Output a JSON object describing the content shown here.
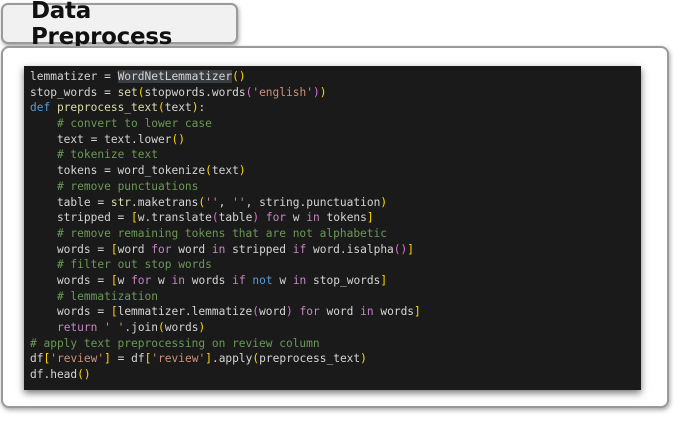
{
  "header": {
    "title": "Data Preprocess"
  },
  "colors": {
    "code_background": "#1a1a1b",
    "keyword": "#569cd6",
    "control_keyword": "#c586c0",
    "string": "#ce9178",
    "comment": "#6a9955",
    "function": "#dcdcaa",
    "plain": "#d4d4d4"
  },
  "code": {
    "language": "python",
    "lines": [
      [
        [
          "plain",
          "lemmatizer = "
        ],
        [
          "hl",
          "WordNetLemmatizer"
        ],
        [
          "paren",
          "()"
        ]
      ],
      [
        [
          "plain",
          "stop_words = "
        ],
        [
          "builtin",
          "set"
        ],
        [
          "paren",
          "("
        ],
        [
          "plain",
          "stopwords.words"
        ],
        [
          "bracket",
          "("
        ],
        [
          "str",
          "'english'"
        ],
        [
          "bracket",
          ")"
        ],
        [
          "paren",
          ")"
        ]
      ],
      [
        [
          "kw",
          "def "
        ],
        [
          "fn",
          "preprocess_text"
        ],
        [
          "paren",
          "("
        ],
        [
          "plain",
          "text"
        ],
        [
          "paren",
          ")"
        ],
        [
          "plain",
          ":"
        ]
      ],
      [
        [
          "plain",
          "    "
        ],
        [
          "comment",
          "# convert to lower case"
        ]
      ],
      [
        [
          "plain",
          "    text = text.lower"
        ],
        [
          "paren",
          "()"
        ]
      ],
      [
        [
          "plain",
          "    "
        ],
        [
          "comment",
          "# tokenize text"
        ]
      ],
      [
        [
          "plain",
          "    tokens = word_tokenize"
        ],
        [
          "paren",
          "("
        ],
        [
          "plain",
          "text"
        ],
        [
          "paren",
          ")"
        ]
      ],
      [
        [
          "plain",
          "    "
        ],
        [
          "comment",
          "# remove punctuations"
        ]
      ],
      [
        [
          "plain",
          "    table = "
        ],
        [
          "builtin",
          "str"
        ],
        [
          "plain",
          ".maketrans"
        ],
        [
          "paren",
          "("
        ],
        [
          "str",
          "''"
        ],
        [
          "plain",
          ", "
        ],
        [
          "str",
          "''"
        ],
        [
          "plain",
          ", string.punctuation"
        ],
        [
          "paren",
          ")"
        ]
      ],
      [
        [
          "plain",
          "    stripped = "
        ],
        [
          "paren",
          "["
        ],
        [
          "plain",
          "w.translate"
        ],
        [
          "bracket",
          "("
        ],
        [
          "plain",
          "table"
        ],
        [
          "bracket",
          ")"
        ],
        [
          "plain",
          " "
        ],
        [
          "ctrl",
          "for"
        ],
        [
          "plain",
          " w "
        ],
        [
          "ctrl",
          "in"
        ],
        [
          "plain",
          " tokens"
        ],
        [
          "paren",
          "]"
        ]
      ],
      [
        [
          "plain",
          "    "
        ],
        [
          "comment",
          "# remove remaining tokens that are not alphabetic"
        ]
      ],
      [
        [
          "plain",
          "    words = "
        ],
        [
          "paren",
          "["
        ],
        [
          "plain",
          "word "
        ],
        [
          "ctrl",
          "for"
        ],
        [
          "plain",
          " word "
        ],
        [
          "ctrl",
          "in"
        ],
        [
          "plain",
          " stripped "
        ],
        [
          "ctrl",
          "if"
        ],
        [
          "plain",
          " word.isalpha"
        ],
        [
          "bracket",
          "()"
        ],
        [
          "paren",
          "]"
        ]
      ],
      [
        [
          "plain",
          "    "
        ],
        [
          "comment",
          "# filter out stop words"
        ]
      ],
      [
        [
          "plain",
          "    words = "
        ],
        [
          "paren",
          "["
        ],
        [
          "plain",
          "w "
        ],
        [
          "ctrl",
          "for"
        ],
        [
          "plain",
          " w "
        ],
        [
          "ctrl",
          "in"
        ],
        [
          "plain",
          " words "
        ],
        [
          "ctrl",
          "if"
        ],
        [
          "plain",
          " "
        ],
        [
          "kw",
          "not"
        ],
        [
          "plain",
          " w "
        ],
        [
          "ctrl",
          "in"
        ],
        [
          "plain",
          " stop_words"
        ],
        [
          "paren",
          "]"
        ]
      ],
      [
        [
          "plain",
          "    "
        ],
        [
          "comment",
          "# lemmatization"
        ]
      ],
      [
        [
          "plain",
          "    words = "
        ],
        [
          "paren",
          "["
        ],
        [
          "plain",
          "lemmatizer.lemmatize"
        ],
        [
          "bracket",
          "("
        ],
        [
          "plain",
          "word"
        ],
        [
          "bracket",
          ")"
        ],
        [
          "plain",
          " "
        ],
        [
          "ctrl",
          "for"
        ],
        [
          "plain",
          " word "
        ],
        [
          "ctrl",
          "in"
        ],
        [
          "plain",
          " words"
        ],
        [
          "paren",
          "]"
        ]
      ],
      [
        [
          "plain",
          "    "
        ],
        [
          "ctrl",
          "return"
        ],
        [
          "plain",
          " "
        ],
        [
          "str",
          "' '"
        ],
        [
          "plain",
          ".join"
        ],
        [
          "paren",
          "("
        ],
        [
          "plain",
          "words"
        ],
        [
          "paren",
          ")"
        ]
      ],
      [
        [
          "comment",
          "# apply text preprocessing on review column"
        ]
      ],
      [
        [
          "plain",
          "df"
        ],
        [
          "paren",
          "["
        ],
        [
          "str",
          "'review'"
        ],
        [
          "paren",
          "]"
        ],
        [
          "plain",
          " = df"
        ],
        [
          "paren",
          "["
        ],
        [
          "str",
          "'review'"
        ],
        [
          "paren",
          "]"
        ],
        [
          "plain",
          ".apply"
        ],
        [
          "paren",
          "("
        ],
        [
          "plain",
          "preprocess_text"
        ],
        [
          "paren",
          ")"
        ]
      ],
      [
        [
          "plain",
          "df.head"
        ],
        [
          "paren",
          "()"
        ]
      ]
    ]
  }
}
